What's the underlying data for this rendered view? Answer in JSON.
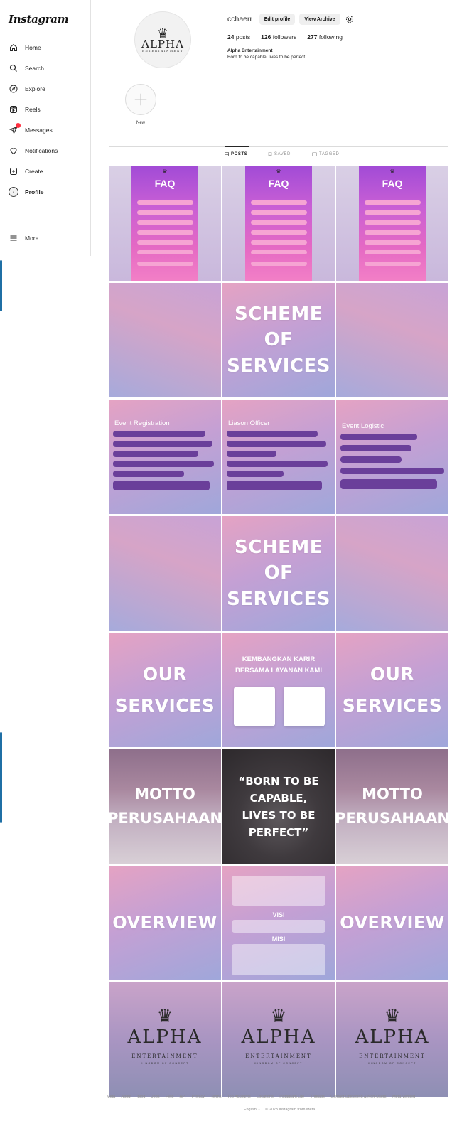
{
  "sidebar": {
    "logo": "Instagram",
    "items": [
      {
        "label": "Home"
      },
      {
        "label": "Search"
      },
      {
        "label": "Explore"
      },
      {
        "label": "Reels"
      },
      {
        "label": "Messages"
      },
      {
        "label": "Notifications"
      },
      {
        "label": "Create"
      },
      {
        "label": "Profile"
      }
    ],
    "more": "More"
  },
  "profile": {
    "username": "cchaerr",
    "edit_label": "Edit profile",
    "archive_label": "View Archive",
    "posts_count": "24",
    "posts_label": "posts",
    "followers_count": "126",
    "followers_label": "followers",
    "following_count": "277",
    "following_label": "following",
    "bio_name": "Alpha Entertainment",
    "bio_text": "Born to be capable, lives to be perfect"
  },
  "avatar_logo": {
    "word": "LPHA",
    "sub": "ENTERTAINMENT"
  },
  "highlight": {
    "label": "New"
  },
  "tabs": [
    {
      "label": "POSTS"
    },
    {
      "label": "SAVED"
    },
    {
      "label": "TAGGED"
    }
  ],
  "posts": {
    "faq_title": "FAQ",
    "scheme": [
      "SCHEME",
      "OF",
      "SERVICES"
    ],
    "event_registration": "Event Registration",
    "liason_officer": "Liason Officer",
    "event_logistic": "Event Logistic",
    "our_services": [
      "OUR",
      "SERVICES"
    ],
    "karir": [
      "KEMBANGKAN KARIR",
      "BERSAMA LAYANAN KAMI"
    ],
    "motto": [
      "MOTTO",
      "PERUSAHAAN"
    ],
    "quote": [
      "“BORN TO BE",
      "CAPABLE,",
      "LIVES TO BE",
      "PERFECT”"
    ],
    "overview": "OVERVIEW",
    "visi": "VISI",
    "misi": "MISI",
    "alpha_word": "LPHA",
    "alpha_sub": "ENTERTAINMENT",
    "alpha_tiny": "KINGDOM OF CONCEPT"
  },
  "footer": {
    "links": [
      "Meta",
      "About",
      "Blog",
      "Jobs",
      "Help",
      "API",
      "Privacy",
      "Terms",
      "Top Accounts",
      "Locations",
      "Instagram Lite",
      "Threads",
      "Contact Uploading & Non-Users",
      "Meta Verified"
    ],
    "language": "English",
    "copyright": "© 2023 Instagram from Meta"
  }
}
